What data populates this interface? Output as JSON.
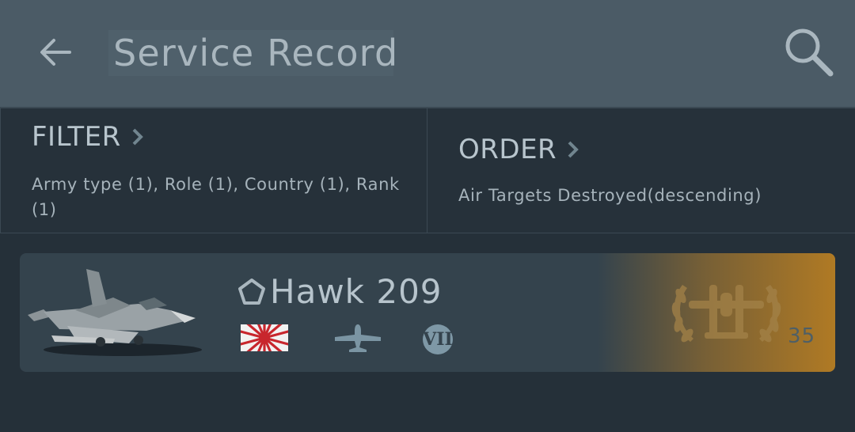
{
  "header": {
    "title": "Service Record",
    "back_icon": "arrow-left-icon",
    "search_icon": "search-icon"
  },
  "filter": {
    "label": "FILTER",
    "summary": "Army type (1), Role (1), Country (1), Rank (1)"
  },
  "order": {
    "label": "ORDER",
    "summary": "Air Targets Destroyed(descending)"
  },
  "vehicle": {
    "name": "Hawk 209",
    "country_flag": "japan-rising-sun-flag",
    "type_icon": "fighter-plane-icon",
    "rank": "VII",
    "achievement_icon": "laurel-aircraft-emblem",
    "stat_value": "35"
  },
  "colors": {
    "header_bg": "#4b5b66",
    "page_bg": "#253039",
    "card_bg": "#34434d",
    "accent_gold": "#b07a24"
  }
}
